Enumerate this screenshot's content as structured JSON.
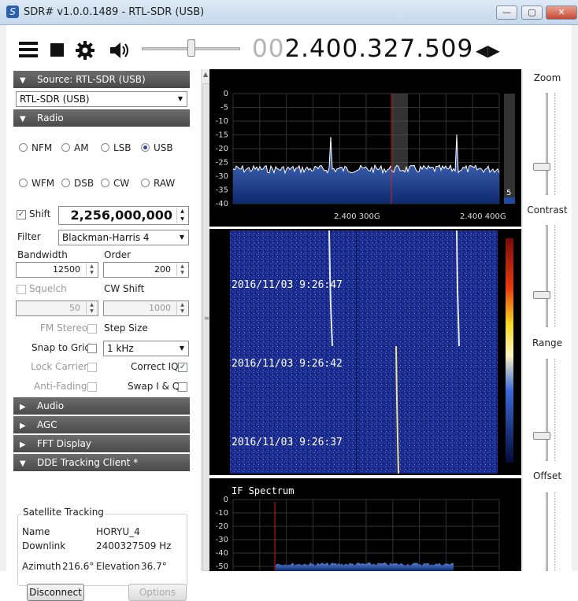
{
  "window": {
    "title": "SDR# v1.0.0.1489 - RTL-SDR (USB)",
    "min": "—",
    "max": "▢",
    "close": "✕"
  },
  "toolbar": {
    "freq_prefix": "00",
    "freq_main": "2.400.327.509",
    "freq_arrows": "◀▶"
  },
  "source": {
    "header": "Source: RTL-SDR (USB)",
    "device": "RTL-SDR (USB)"
  },
  "radio": {
    "header": "Radio",
    "modes": [
      "NFM",
      "AM",
      "LSB",
      "USB",
      "WFM",
      "DSB",
      "CW",
      "RAW"
    ],
    "selected_mode": "USB",
    "shift_label": "Shift",
    "shift_value": "2,256,000,000",
    "filter_label": "Filter",
    "filter_value": "Blackman-Harris 4",
    "bandwidth_label": "Bandwidth",
    "bandwidth_value": "12500",
    "order_label": "Order",
    "order_value": "200",
    "squelch_label": "Squelch",
    "squelch_value": "50",
    "cwshift_label": "CW Shift",
    "cwshift_value": "1000",
    "fmstereo_label": "FM Stereo",
    "stepsize_label": "Step Size",
    "snap_label": "Snap to Grid",
    "snap_value": "1 kHz",
    "lockcarrier_label": "Lock Carrier",
    "correctiq_label": "Correct IQ",
    "antifading_label": "Anti-Fading",
    "swapiq_label": "Swap I & Q"
  },
  "sections": {
    "audio": "Audio",
    "agc": "AGC",
    "fft": "FFT Display",
    "dde": "DDE Tracking Client *"
  },
  "tracking": {
    "group": "Satellite Tracking",
    "name_label": "Name",
    "name_value": "HORYU_4",
    "downlink_label": "Downlink",
    "downlink_value": "2400327509 Hz",
    "azimuth_label": "Azimuth",
    "azimuth_value": "216.6°",
    "elevation_label": "Elevation",
    "elevation_value": "36.7°",
    "disconnect": "Disconnect",
    "options": "Options"
  },
  "spectrum": {
    "yticks": [
      "0",
      "-5",
      "-10",
      "-15",
      "-20",
      "-25",
      "-30",
      "-35",
      "-40"
    ],
    "xticks": [
      "2.400 300G",
      "2.400 400G"
    ],
    "scale_value": "5"
  },
  "waterfall": {
    "timestamps": [
      "2016/11/03 9:26:47",
      "2016/11/03 9:26:42",
      "2016/11/03 9:26:37"
    ]
  },
  "if_spectrum": {
    "title": "IF Spectrum",
    "yticks": [
      "0",
      "-10",
      "-20",
      "-30",
      "-40",
      "-50"
    ]
  },
  "right": {
    "zoom": "Zoom",
    "contrast": "Contrast",
    "range": "Range",
    "offset": "Offset"
  },
  "colors": {
    "accent": "#2b4d8c",
    "spectrum_fill": "#1e4aa0",
    "marker": "#d22222"
  }
}
